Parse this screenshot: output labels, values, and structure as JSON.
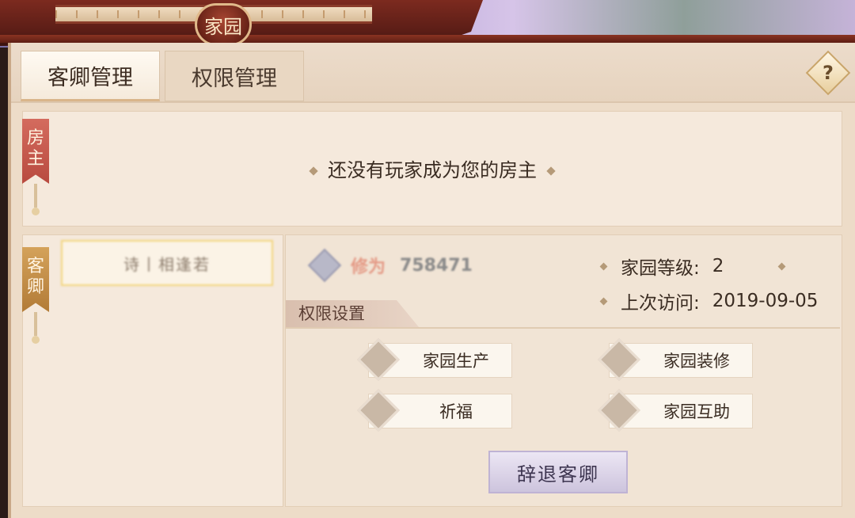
{
  "window": {
    "title": "家园"
  },
  "tabs": [
    {
      "label": "客卿管理",
      "active": true
    },
    {
      "label": "权限管理",
      "active": false
    }
  ],
  "help": {
    "label": "?"
  },
  "owner": {
    "banner": "房主",
    "empty_text": "还没有玩家成为您的房主"
  },
  "guests": {
    "banner": "客卿",
    "items": [
      {
        "name": "诗丨相逢若"
      }
    ]
  },
  "detail": {
    "cultivation_label": "修为",
    "cultivation_value": "758471",
    "home_level_label": "家园等级:",
    "home_level_value": "2",
    "last_visit_label": "上次访问:",
    "last_visit_value": "2019-09-05",
    "permissions_title": "权限设置",
    "permissions": [
      {
        "label": "家园生产"
      },
      {
        "label": "家园装修"
      },
      {
        "label": "祈福"
      },
      {
        "label": "家园互助"
      }
    ],
    "dismiss_label": "辞退客卿"
  }
}
